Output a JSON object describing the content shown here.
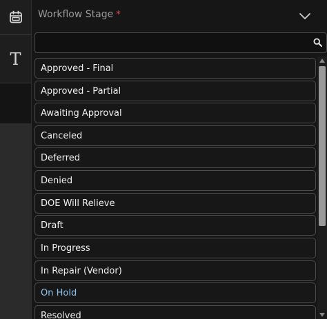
{
  "rail": {
    "icons": [
      "calendar-icon",
      "text-field-icon"
    ],
    "text_glyph": "T"
  },
  "field": {
    "label": "Workflow Stage",
    "required_mark": "*",
    "required_color": "#e0474c"
  },
  "search": {
    "value": "",
    "placeholder": ""
  },
  "options": [
    "Approved - Final",
    "Approved - Partial",
    "Awaiting Approval",
    "Canceled",
    "Deferred",
    "Denied",
    "DOE Will Relieve",
    "Draft",
    "In Progress",
    "In Repair (Vendor)",
    "On Hold",
    "Resolved"
  ],
  "highlighted_option": "On Hold",
  "colors": {
    "highlight_text": "#8fc4ee",
    "panel_bg": "#161616",
    "option_border": "#4d4d4d"
  }
}
